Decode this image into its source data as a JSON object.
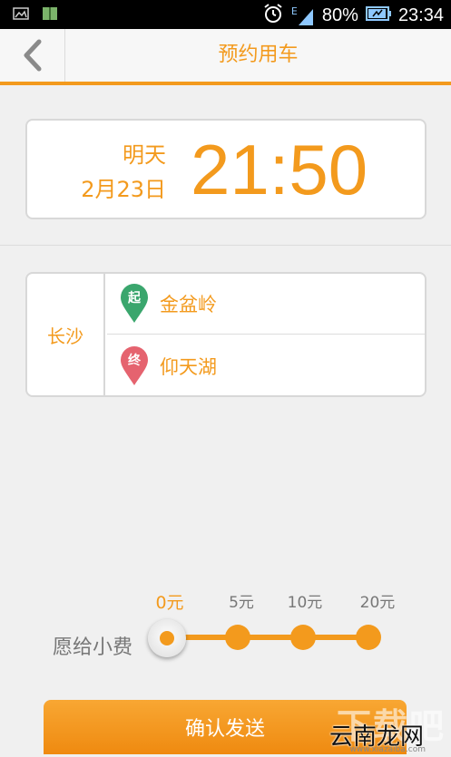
{
  "status_bar": {
    "battery": "80%",
    "time": "23:34",
    "network": "E",
    "icons": [
      "image-icon",
      "book-icon",
      "alarm-icon",
      "signal-icon",
      "battery-icon"
    ]
  },
  "header": {
    "title": "预约用车",
    "back_icon": "chevron-left-icon"
  },
  "schedule": {
    "day": "明天",
    "date": "2月23日",
    "time": "21:50"
  },
  "route": {
    "city": "长沙",
    "start_marker": "起",
    "start": "金盆岭",
    "end_marker": "终",
    "end": "仰天湖"
  },
  "tip": {
    "label": "愿给小费",
    "options": [
      "0元",
      "5元",
      "10元",
      "20元"
    ],
    "selected_index": 0
  },
  "confirm": {
    "label": "确认发送"
  },
  "watermark": {
    "big": "下载吧",
    "small": "云南龙网",
    "url": "www.xiazaiba.com"
  },
  "colors": {
    "accent": "#f39a1d",
    "start_pin": "#3aa66d",
    "end_pin": "#e5636f"
  }
}
